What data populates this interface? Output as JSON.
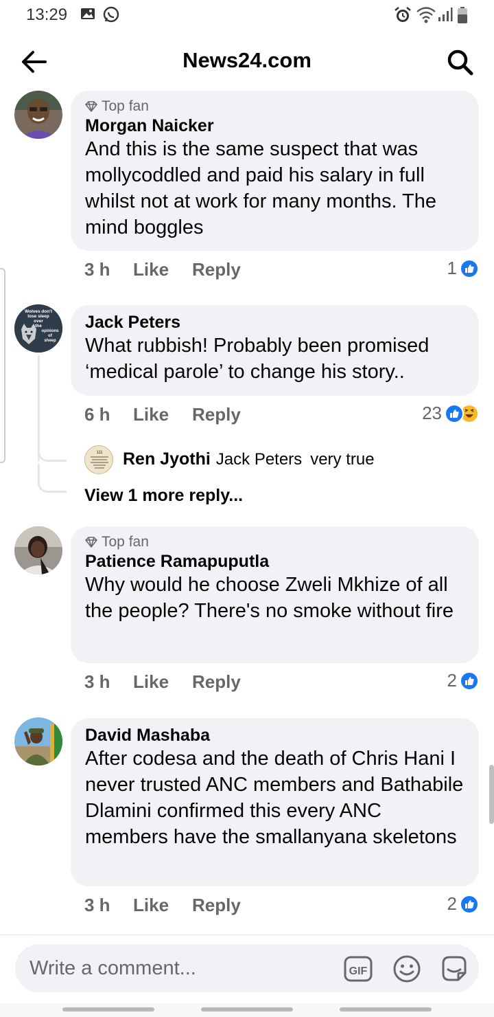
{
  "status_bar": {
    "time": "13:29"
  },
  "header": {
    "title": "News24.com"
  },
  "comments": [
    {
      "badge": "Top fan",
      "author": "Morgan Naicker",
      "text": "And this is the same suspect that was mollycoddled and paid his salary in full whilst not at work for many months. The mind boggles",
      "time": "3 h",
      "like": "Like",
      "reply": "Reply",
      "reaction_count": "1"
    },
    {
      "author": "Jack Peters",
      "avatar_text": "Wolves don't lose sleep over the opinions of sheep",
      "text": "What rubbish! Probably been promised ‘medical parole’ to change his story..",
      "time": "6 h",
      "like": "Like",
      "reply": "Reply",
      "reaction_count": "23",
      "reply_preview": {
        "author": "Ren Jyothi",
        "mention": "Jack Peters",
        "text": "very true"
      },
      "view_more": "View 1 more reply..."
    },
    {
      "badge": "Top fan",
      "author": "Patience Ramapuputla",
      "text": "Why would he choose Zweli Mkhize of all the people? There's no smoke without fire",
      "time": "3 h",
      "like": "Like",
      "reply": "Reply",
      "reaction_count": "2"
    },
    {
      "author": "David Mashaba",
      "text": "After codesa  and the death of Chris Hani I never trusted ANC members and Bathabile Dlamini confirmed this every ANC members have the smallanyana skeletons",
      "time": "3 h",
      "like": "Like",
      "reply": "Reply",
      "reaction_count": "2"
    }
  ],
  "composer": {
    "placeholder": "Write a comment...",
    "gif_label": "GIF"
  },
  "colors": {
    "like_blue": "#1877f2",
    "haha_yellow": "#f7b928",
    "bubble": "#f0f2f5",
    "muted": "#65676b"
  }
}
